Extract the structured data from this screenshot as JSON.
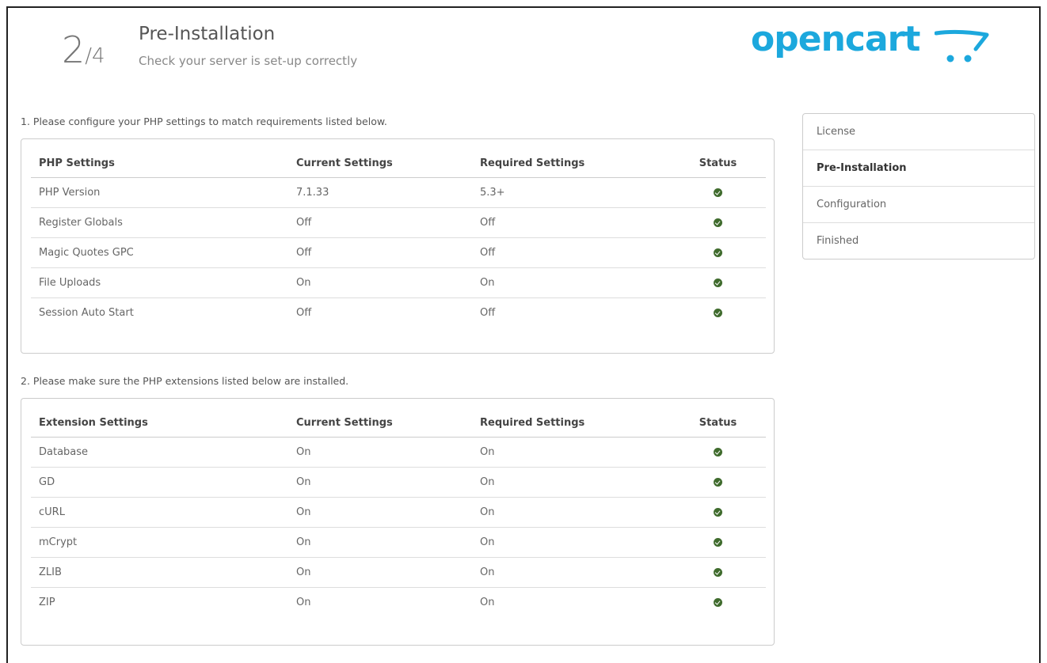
{
  "header": {
    "step_current": "2",
    "step_total": "/4",
    "title": "Pre-Installation",
    "subtitle": "Check your server is set-up correctly",
    "logo_text": "opencart"
  },
  "section1": {
    "label": "1. Please configure your PHP settings to match requirements listed below.",
    "columns": [
      "PHP Settings",
      "Current Settings",
      "Required Settings",
      "Status"
    ],
    "rows": [
      {
        "name": "PHP Version",
        "current": "7.1.33",
        "required": "5.3+",
        "status": "ok"
      },
      {
        "name": "Register Globals",
        "current": "Off",
        "required": "Off",
        "status": "ok"
      },
      {
        "name": "Magic Quotes GPC",
        "current": "Off",
        "required": "Off",
        "status": "ok"
      },
      {
        "name": "File Uploads",
        "current": "On",
        "required": "On",
        "status": "ok"
      },
      {
        "name": "Session Auto Start",
        "current": "Off",
        "required": "Off",
        "status": "ok"
      }
    ]
  },
  "section2": {
    "label": "2. Please make sure the PHP extensions listed below are installed.",
    "columns": [
      "Extension Settings",
      "Current Settings",
      "Required Settings",
      "Status"
    ],
    "rows": [
      {
        "name": "Database",
        "current": "On",
        "required": "On",
        "status": "ok"
      },
      {
        "name": "GD",
        "current": "On",
        "required": "On",
        "status": "ok"
      },
      {
        "name": "cURL",
        "current": "On",
        "required": "On",
        "status": "ok"
      },
      {
        "name": "mCrypt",
        "current": "On",
        "required": "On",
        "status": "ok"
      },
      {
        "name": "ZLIB",
        "current": "On",
        "required": "On",
        "status": "ok"
      },
      {
        "name": "ZIP",
        "current": "On",
        "required": "On",
        "status": "ok"
      }
    ]
  },
  "sidenav": {
    "items": [
      {
        "label": "License",
        "active": false
      },
      {
        "label": "Pre-Installation",
        "active": true
      },
      {
        "label": "Configuration",
        "active": false
      },
      {
        "label": "Finished",
        "active": false
      }
    ]
  },
  "colors": {
    "brand": "#1ca8dd",
    "status_ok": "#3f6b2d"
  },
  "icons": {
    "status_ok": "check-circle-icon",
    "logo_cart": "cart-icon"
  }
}
